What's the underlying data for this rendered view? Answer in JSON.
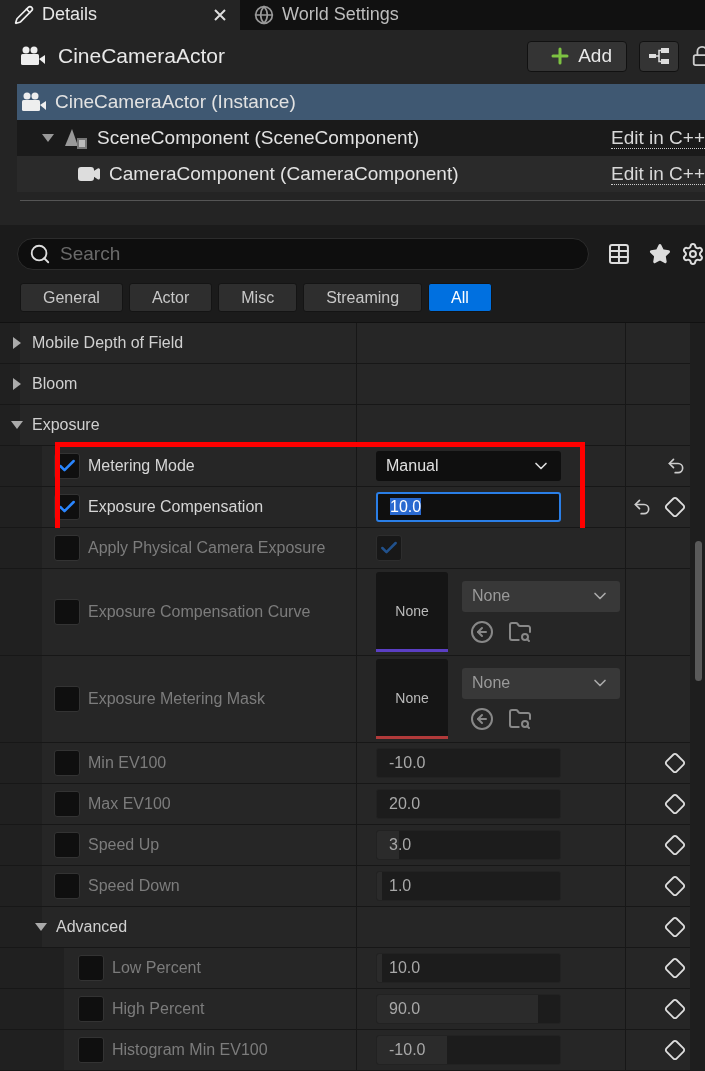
{
  "tabs": [
    {
      "label": "Details",
      "kind": "details",
      "selected": true,
      "closable": true
    },
    {
      "label": "World Settings",
      "kind": "world",
      "selected": false,
      "closable": false
    }
  ],
  "header": {
    "title": "CineCameraActor",
    "add_button": "Add"
  },
  "components": [
    {
      "label": "CineCameraActor (Instance)",
      "kind": "actor",
      "selected": true
    },
    {
      "label": "SceneComponent (SceneComponent)",
      "kind": "scene",
      "selected": false,
      "expanded": true,
      "action": "Edit in C++",
      "children": [
        {
          "label": "CameraComponent (CameraComponent)",
          "kind": "camera",
          "selected": false,
          "action": "Edit in C++"
        }
      ]
    }
  ],
  "search": {
    "placeholder": "Search"
  },
  "filters": [
    {
      "label": "General",
      "selected": false
    },
    {
      "label": "Actor",
      "selected": false
    },
    {
      "label": "Misc",
      "selected": false
    },
    {
      "label": "Streaming",
      "selected": false
    },
    {
      "label": "All",
      "selected": true
    }
  ],
  "properties": [
    {
      "kind": "category",
      "label": "Mobile Depth of Field",
      "expanded": false
    },
    {
      "kind": "category",
      "label": "Bloom",
      "expanded": false
    },
    {
      "kind": "category",
      "label": "Exposure",
      "expanded": true,
      "children": [
        {
          "kind": "dropdown",
          "label": "Metering Mode",
          "checked": true,
          "value": "Manual",
          "resettable": true,
          "keyable": false,
          "highlighted": true
        },
        {
          "kind": "number",
          "label": "Exposure Compensation",
          "checked": true,
          "value": "10.0",
          "focused": true,
          "resettable": true,
          "keyable": true,
          "highlighted": true
        },
        {
          "kind": "bool",
          "label": "Apply Physical Camera Exposure",
          "checked": false,
          "value_checked": true,
          "resettable": false,
          "keyable": false
        },
        {
          "kind": "asset",
          "label": "Exposure Compensation Curve",
          "checked": false,
          "thumbnail": "None",
          "value": "None",
          "color": "#5b3fc4",
          "resettable": false,
          "keyable": false
        },
        {
          "kind": "asset",
          "label": "Exposure Metering Mask",
          "checked": false,
          "thumbnail": "None",
          "value": "None",
          "color": "#b13a3a",
          "resettable": false,
          "keyable": false
        },
        {
          "kind": "number",
          "label": "Min EV100",
          "checked": false,
          "value": "-10.0",
          "resettable": false,
          "keyable": true
        },
        {
          "kind": "number",
          "label": "Max EV100",
          "checked": false,
          "value": "20.0",
          "resettable": false,
          "keyable": true
        },
        {
          "kind": "number",
          "label": "Speed Up",
          "checked": false,
          "value": "3.0",
          "level": 0.12,
          "resettable": false,
          "keyable": true
        },
        {
          "kind": "number",
          "label": "Speed Down",
          "checked": false,
          "value": "1.0",
          "level": 0.03,
          "resettable": false,
          "keyable": true
        },
        {
          "kind": "category",
          "label": "Advanced",
          "expanded": true,
          "keyable": true,
          "children": [
            {
              "kind": "number",
              "label": "Low Percent",
              "checked": false,
              "value": "10.0",
              "level": 0.03,
              "resettable": false,
              "keyable": true
            },
            {
              "kind": "number",
              "label": "High Percent",
              "checked": false,
              "value": "90.0",
              "level": 0.88,
              "resettable": false,
              "keyable": true
            },
            {
              "kind": "number",
              "label": "Histogram Min EV100",
              "checked": false,
              "value": "-10.0",
              "level": 0.38,
              "resettable": false,
              "keyable": true
            }
          ]
        }
      ]
    }
  ]
}
